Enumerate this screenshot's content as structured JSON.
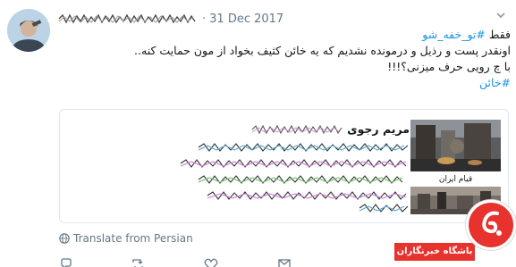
{
  "tweet": {
    "separator": "·",
    "date": "31 Dec 2017",
    "lines": [
      {
        "prefix": "فقط ",
        "hashtag": "#تو_خفه_شو"
      },
      {
        "text": "اونقدر پست و رذیل و درمونده نشدیم که یه خائن کثیف بخواد از مون حمایت کنه.."
      },
      {
        "text": "با چ رویی حرف میزنی؟!!!"
      },
      {
        "hashtag": "#خائن"
      }
    ]
  },
  "card": {
    "title": "مریم رجوی",
    "image_caption": "قیام ایران"
  },
  "translate": {
    "label": "Translate from Persian",
    "icon": "globe-icon"
  },
  "actions": [
    "reply-icon",
    "retweet-icon",
    "like-icon",
    "message-icon"
  ],
  "badge": {
    "label": "باشگاه خبرنگاران"
  },
  "colors": {
    "link": "#1b95e0",
    "muted": "#657786",
    "border": "#e1e8ed",
    "badge": "#e7322d"
  }
}
